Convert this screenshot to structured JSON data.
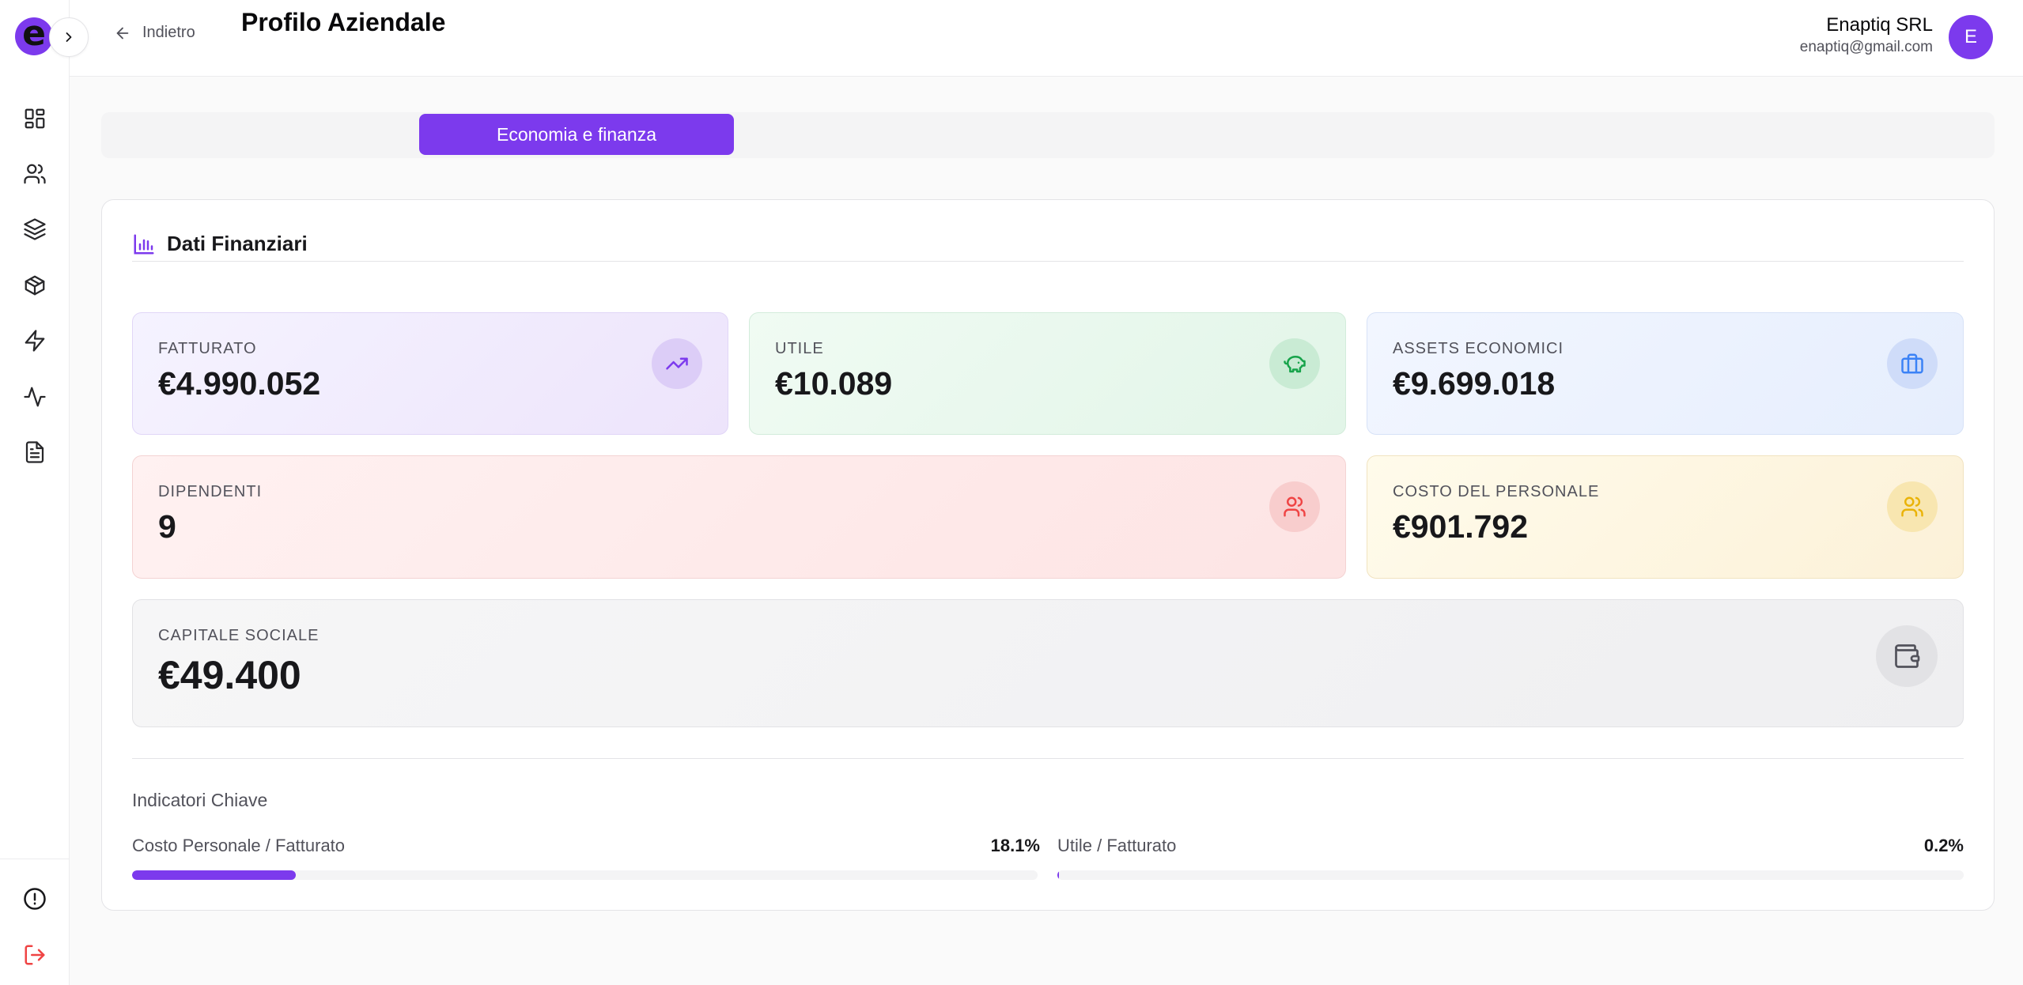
{
  "app": {
    "logo_letter": "e"
  },
  "header": {
    "back_label": "Indietro",
    "title": "Profilo Aziendale",
    "company_name": "Enaptiq SRL",
    "company_email": "enaptiq@gmail.com",
    "avatar_initial": "E"
  },
  "tabs": {
    "active_label": "Economia e finanza"
  },
  "section": {
    "title": "Dati Finanziari"
  },
  "stats": {
    "fatturato": {
      "label": "Fatturato",
      "value": "€4.990.052",
      "icon": "trending-up-icon"
    },
    "utile": {
      "label": "Utile",
      "value": "€10.089",
      "icon": "piggy-bank-icon"
    },
    "assets": {
      "label": "Assets Economici",
      "value": "€9.699.018",
      "icon": "briefcase-icon"
    },
    "dipendenti": {
      "label": "Dipendenti",
      "value": "9",
      "icon": "users-icon"
    },
    "costo_personale": {
      "label": "Costo del Personale",
      "value": "€901.792",
      "icon": "users-icon"
    },
    "capitale_sociale": {
      "label": "Capitale Sociale",
      "value": "€49.400",
      "icon": "wallet-icon"
    }
  },
  "indicators": {
    "title": "Indicatori Chiave",
    "items": [
      {
        "label": "Costo Personale / Fatturato",
        "value": "18.1%",
        "fraction": 0.181
      },
      {
        "label": "Utile / Fatturato",
        "value": "0.2%",
        "fraction": 0.002
      }
    ]
  },
  "colors": {
    "accent": "#7c3aed",
    "green": "#16a34a",
    "blue": "#3b82f6",
    "red": "#ef4444",
    "amber": "#eab308",
    "gray": "#52525b"
  }
}
